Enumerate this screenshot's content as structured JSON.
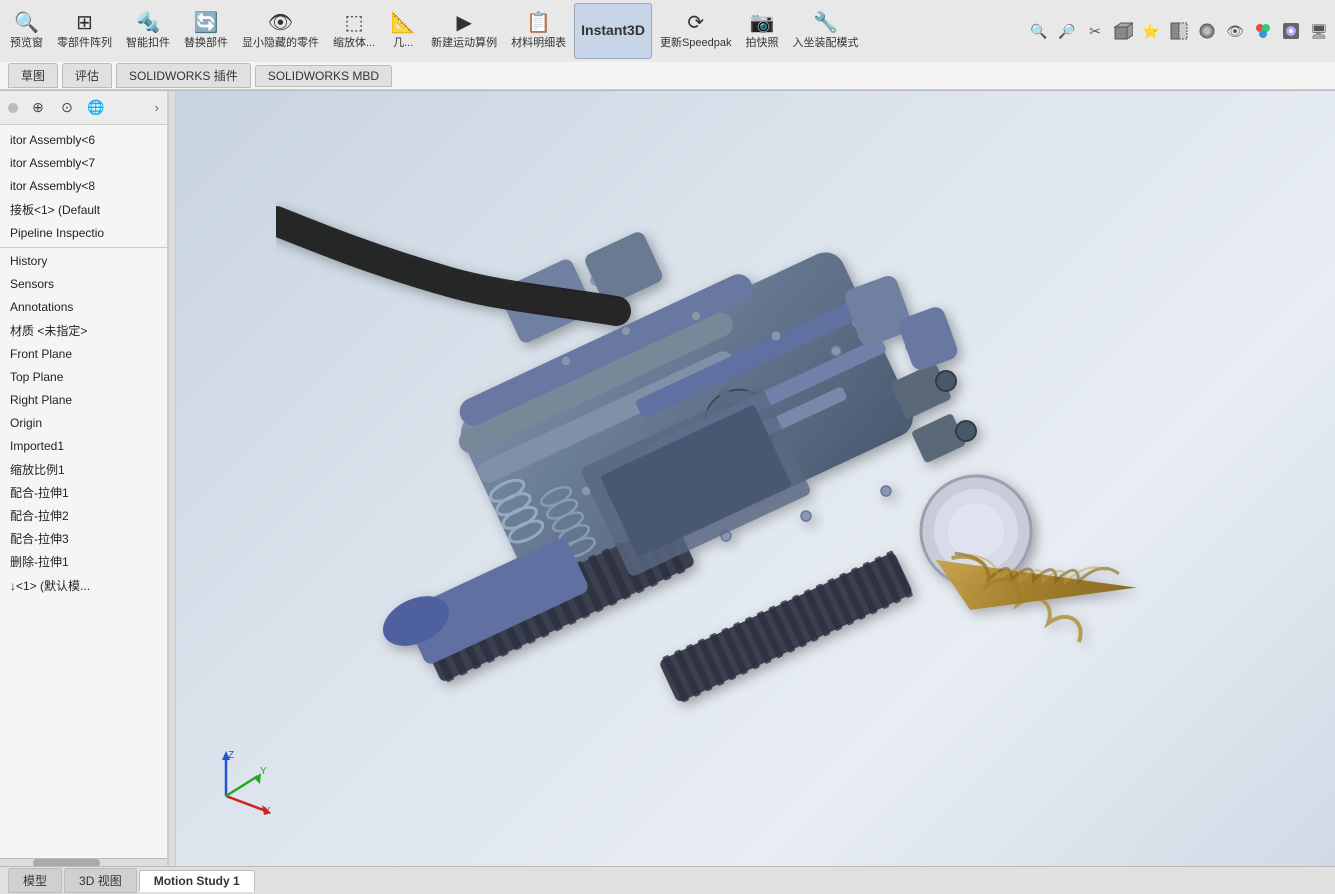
{
  "toolbar": {
    "row1_buttons": [
      {
        "label": "预览窗",
        "icon": "🔍"
      },
      {
        "label": "零部件阵列",
        "icon": "⊞"
      },
      {
        "label": "智能扣件",
        "icon": "🔩"
      },
      {
        "label": "替换部件",
        "icon": "🔄"
      },
      {
        "label": "显小隐藏的零件",
        "icon": "👁"
      },
      {
        "label": "缩放体...",
        "icon": "⬚"
      },
      {
        "label": "几...",
        "icon": "📐"
      },
      {
        "label": "新建运动算例",
        "icon": "▶"
      },
      {
        "label": "材料明细表",
        "icon": "📋"
      },
      {
        "label": "Instant3D",
        "icon": "3D"
      },
      {
        "label": "更新Speedpak",
        "icon": "⟳"
      },
      {
        "label": "拍快照",
        "icon": "📷"
      },
      {
        "label": "入坐装配模式",
        "icon": "🔧"
      }
    ],
    "row2_tabs": [
      "草图",
      "评估",
      "SOLIDWORKS 插件",
      "SOLIDWORKS MBD"
    ]
  },
  "right_toolbar_icons": [
    "🔍",
    "🔎",
    "✂",
    "⬜",
    "⭐",
    "⬛",
    "⬜",
    "◉",
    "👁",
    "🎨",
    "🖼",
    "🖥"
  ],
  "left_panel": {
    "panel_icons": [
      "⊕",
      "⊕",
      "🌐"
    ],
    "tree_items": [
      {
        "label": "itor Assembly<6",
        "indent": 0
      },
      {
        "label": "itor Assembly<7",
        "indent": 0
      },
      {
        "label": "itor Assembly<8",
        "indent": 0
      },
      {
        "label": "接板<1> (Default",
        "indent": 0
      },
      {
        "label": "Pipeline Inspectio",
        "indent": 0
      },
      {
        "label": "History",
        "indent": 0
      },
      {
        "label": "Sensors",
        "indent": 0
      },
      {
        "label": "Annotations",
        "indent": 0
      },
      {
        "label": "材质 <未指定>",
        "indent": 0
      },
      {
        "label": "Front Plane",
        "indent": 0
      },
      {
        "label": "Top Plane",
        "indent": 0
      },
      {
        "label": "Right Plane",
        "indent": 0
      },
      {
        "label": "Origin",
        "indent": 0
      },
      {
        "label": "Imported1",
        "indent": 0
      },
      {
        "label": "缩放比例1",
        "indent": 0
      },
      {
        "label": "配合-拉伸1",
        "indent": 0
      },
      {
        "label": "配合-拉伸2",
        "indent": 0
      },
      {
        "label": "配合-拉伸3",
        "indent": 0
      },
      {
        "label": "删除-拉伸1",
        "indent": 0
      },
      {
        "label": "↓<1> (默认模...",
        "indent": 0
      }
    ]
  },
  "bottom_tabs": [
    "模型",
    "3D 视图",
    "Motion Study 1"
  ],
  "axis": {
    "x_color": "#cc0000",
    "y_color": "#00aa00",
    "z_color": "#0055cc"
  }
}
